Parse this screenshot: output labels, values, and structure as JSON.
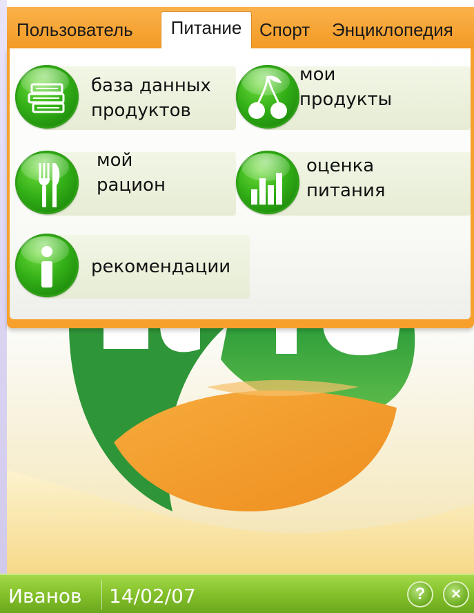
{
  "colors": {
    "tab_bar": "#f29a26",
    "accent_green": "#33b017",
    "status_bar": "#85c22c",
    "logo_green": "#3aa12f",
    "logo_orange": "#f29a26"
  },
  "tabs": [
    {
      "label": "Пользователь",
      "active": false
    },
    {
      "label": "Питание",
      "active": true
    },
    {
      "label": "Спорт",
      "active": false
    },
    {
      "label": "Энциклопедия",
      "active": false
    }
  ],
  "menu": {
    "items": [
      {
        "label": "база данных\nпродуктов",
        "icon": "books-icon"
      },
      {
        "label": "мои\nпродукты",
        "icon": "cherries-icon"
      },
      {
        "label": "мой\nрацион",
        "icon": "fork-icon"
      },
      {
        "label": "оценка\nпитания",
        "icon": "bar-chart-icon"
      },
      {
        "label": "рекомендации",
        "icon": "info-icon"
      }
    ]
  },
  "status": {
    "user": "Иванов",
    "date": "14/02/07",
    "help_label": "?",
    "close_label": "×"
  }
}
